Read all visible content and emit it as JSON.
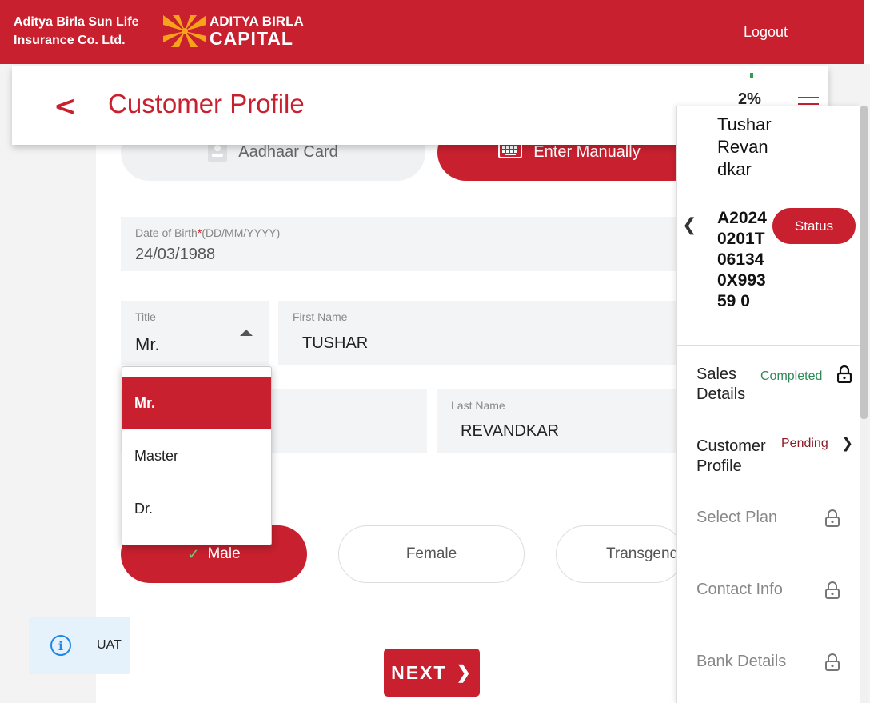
{
  "header": {
    "company_line1": "Aditya Birla Sun Life",
    "company_line2": "Insurance Co. Ltd.",
    "logo_line1": "ADITYA BIRLA",
    "logo_line2": "CAPITAL",
    "logout_label": "Logout",
    "brand_color": "#c8202f"
  },
  "page": {
    "title": "Customer Profile",
    "progress": "2%"
  },
  "tabs": {
    "aadhaar": "Aadhaar Card",
    "manual": "Enter Manually"
  },
  "form": {
    "dob_label": "Date of Birth",
    "dob_required": "*",
    "dob_format": "(DD/MM/YYYY)",
    "dob_value": "24/03/1988",
    "title_label": "Title",
    "title_value": "Mr.",
    "first_name_label": "First Name",
    "first_name_value": "TUSHAR",
    "last_name_label": "Last Name",
    "last_name_value": "REVANDKAR"
  },
  "title_options": [
    "Mr.",
    "Master",
    "Dr."
  ],
  "gender": {
    "male": "Male",
    "female": "Female",
    "transgender": "Transgender",
    "selected": "Male"
  },
  "next_label": "NEXT",
  "env_badge": "UAT",
  "side_panel": {
    "customer_name": "Tushar Revandkar",
    "application_id": "A20240201T061340X99359 0",
    "status_button": "Status",
    "steps": [
      {
        "label": "Sales Details",
        "status": "Completed",
        "icon": "lock-icon"
      },
      {
        "label": "Customer Profile",
        "status": "Pending",
        "icon": "chevron-right-icon"
      },
      {
        "label": "Select Plan",
        "status": "",
        "icon": "lock-icon"
      },
      {
        "label": "Contact Info",
        "status": "",
        "icon": "lock-icon"
      },
      {
        "label": "Bank Details",
        "status": "",
        "icon": "lock-icon"
      }
    ]
  }
}
